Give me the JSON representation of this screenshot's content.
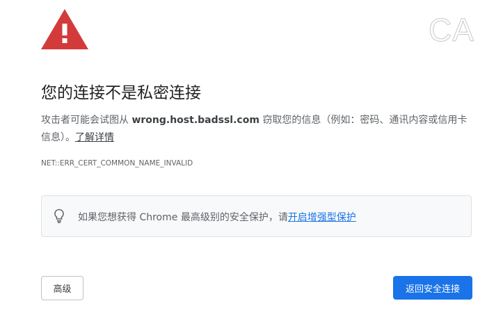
{
  "watermark": "CA",
  "title": "您的连接不是私密连接",
  "description": {
    "prefix": "攻击者可能会试图从 ",
    "host": "wrong.host.badssl.com",
    "suffix": " 窃取您的信息（例如：密码、通讯内容或信用卡信息）。",
    "learn_more": "了解详情"
  },
  "error_code": "NET::ERR_CERT_COMMON_NAME_INVALID",
  "enhanced": {
    "text": "如果您想获得 Chrome 最高级别的安全保护，请",
    "link": "开启增强型保护"
  },
  "buttons": {
    "advanced": "高级",
    "back": "返回安全连接"
  },
  "colors": {
    "accent": "#1a73e8",
    "warning": "#d93025"
  }
}
